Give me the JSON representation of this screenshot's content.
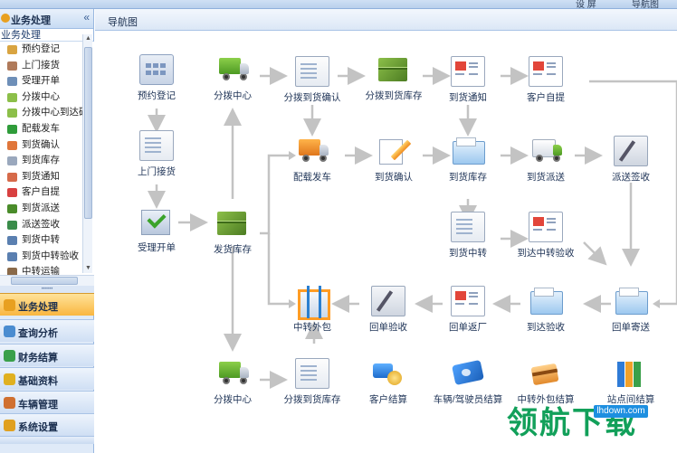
{
  "topbar": {
    "item1": "设 屏",
    "item2": "导航图"
  },
  "sidebar": {
    "title": "业务处理",
    "collapse_icon": "«",
    "section": "业务处理",
    "tree": [
      {
        "label": "预约登记",
        "color": "#d9a441"
      },
      {
        "label": "上门接货",
        "color": "#b07a5a"
      },
      {
        "label": "受理开单",
        "color": "#6e8fb8"
      },
      {
        "label": "分拨中心",
        "color": "#8cbf49"
      },
      {
        "label": "分拨中心到达确",
        "color": "#8cbf49"
      },
      {
        "label": "配载发车",
        "color": "#2f9c3a"
      },
      {
        "label": "到货确认",
        "color": "#e0763a"
      },
      {
        "label": "到货库存",
        "color": "#9aa8bd"
      },
      {
        "label": "到货通知",
        "color": "#d66a4a"
      },
      {
        "label": "客户自提",
        "color": "#d84040"
      },
      {
        "label": "到货派送",
        "color": "#4a8c2a"
      },
      {
        "label": "派送签收",
        "color": "#3a8c4a"
      },
      {
        "label": "到货中转",
        "color": "#5a7fb0"
      },
      {
        "label": "到货中转验收",
        "color": "#5a7fb0"
      },
      {
        "label": "中转运输",
        "color": "#8a6a4a"
      }
    ],
    "splitter": "••••••",
    "nav": [
      {
        "label": "业务处理",
        "color": "#e8a020",
        "active": true
      },
      {
        "label": "查询分析",
        "color": "#4a8cd0"
      },
      {
        "label": "财务结算",
        "color": "#3aa04a"
      },
      {
        "label": "基础资料",
        "color": "#e0b020"
      },
      {
        "label": "车辆管理",
        "color": "#d07030"
      },
      {
        "label": "系统设置",
        "color": "#e0a020"
      }
    ]
  },
  "main": {
    "title": "导航图",
    "nodes": [
      {
        "key": "yuyue",
        "label": "预约登记",
        "icon": "grid-icon"
      },
      {
        "key": "shangmen",
        "label": "上门接货",
        "icon": "form-icon"
      },
      {
        "key": "shouli",
        "label": "受理开单",
        "icon": "check-icon"
      },
      {
        "key": "fenbo1",
        "label": "分拨中心",
        "icon": "truck-icon"
      },
      {
        "key": "fahuo",
        "label": "发货库存",
        "icon": "boxes-icon"
      },
      {
        "key": "fenbo2",
        "label": "分拨中心",
        "icon": "truck-icon"
      },
      {
        "key": "fbqr",
        "label": "分拨到货确认",
        "icon": "form-icon"
      },
      {
        "key": "fbkc",
        "label": "分拨到货库存",
        "icon": "boxes-icon"
      },
      {
        "key": "dhtz",
        "label": "到货通知",
        "icon": "window-icon"
      },
      {
        "key": "khzt",
        "label": "客户自提",
        "icon": "news-icon"
      },
      {
        "key": "pzfc",
        "label": "配载发车",
        "icon": "truck-icon"
      },
      {
        "key": "dhqr",
        "label": "到货确认",
        "icon": "pencil-icon"
      },
      {
        "key": "dhkc",
        "label": "到货库存",
        "icon": "folder-icon"
      },
      {
        "key": "dhps",
        "label": "到货派送",
        "icon": "truck-icon"
      },
      {
        "key": "psqs",
        "label": "派送签收",
        "icon": "sign-icon"
      },
      {
        "key": "dhzz",
        "label": "到货中转",
        "icon": "form-icon"
      },
      {
        "key": "ddzzys",
        "label": "到达中转验收",
        "icon": "window-icon"
      },
      {
        "key": "zzwb",
        "label": "中转外包",
        "icon": "hash-icon"
      },
      {
        "key": "hdys",
        "label": "回单验收",
        "icon": "sign-icon"
      },
      {
        "key": "hdfc",
        "label": "回单返厂",
        "icon": "news-icon"
      },
      {
        "key": "ddys",
        "label": "到达验收",
        "icon": "folder-icon"
      },
      {
        "key": "hdjs",
        "label": "回单寄送",
        "icon": "folder-icon"
      },
      {
        "key": "fbdhkc2",
        "label": "分拨到货库存",
        "icon": "form-icon"
      },
      {
        "key": "khjs",
        "label": "客户结算",
        "icon": "coins-icon"
      },
      {
        "key": "clsjy",
        "label": "车辆/驾驶员结算",
        "icon": "card-icon"
      },
      {
        "key": "zzwbjs",
        "label": "中转外包结算",
        "icon": "gold-icon"
      },
      {
        "key": "zdjs",
        "label": "站点间结算",
        "icon": "books-icon"
      }
    ]
  },
  "watermark": {
    "text": "领航下载",
    "url": "lhdown.com"
  }
}
